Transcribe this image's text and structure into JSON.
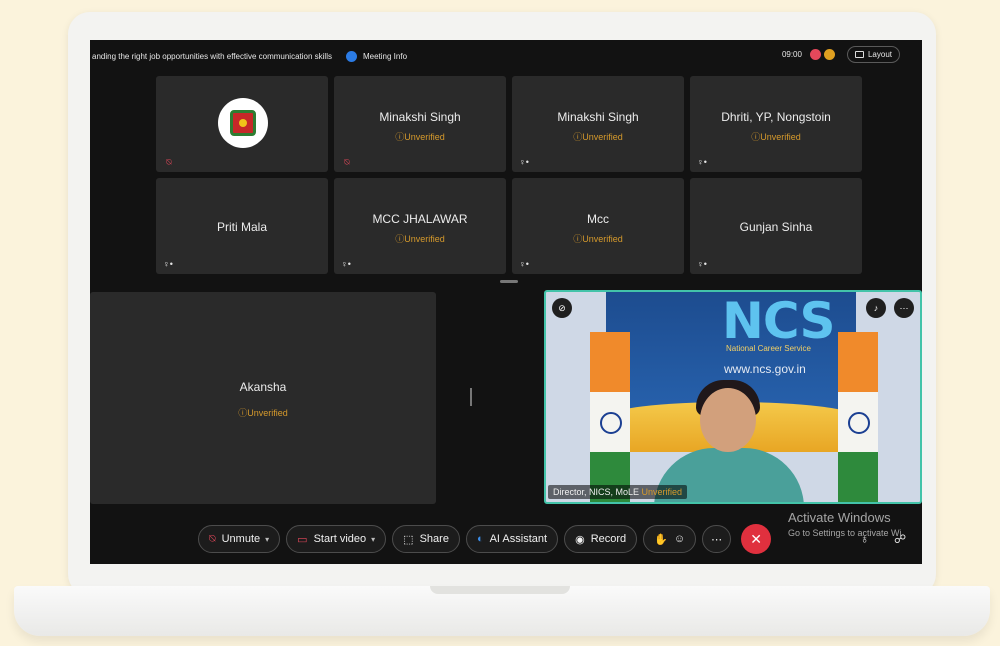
{
  "meeting": {
    "title": "anding the right job opportunities with effective communication skills",
    "info_label": "Meeting Info",
    "time": "09:00",
    "layout_label": "Layout"
  },
  "participants": [
    {
      "name": "",
      "status": "",
      "logo": true
    },
    {
      "name": "Minakshi Singh",
      "status": "ⓘUnverified"
    },
    {
      "name": "Minakshi Singh",
      "status": "ⓘUnverified"
    },
    {
      "name": "Dhriti, YP, Nongstoin",
      "status": "ⓘUnverified"
    },
    {
      "name": "Priti Mala",
      "status": ""
    },
    {
      "name": "MCC JHALAWAR",
      "status": "ⓘUnverified"
    },
    {
      "name": "Mcc",
      "status": "ⓘUnverified"
    },
    {
      "name": "Gunjan Sinha",
      "status": ""
    }
  ],
  "stage": {
    "name": "Akansha",
    "status": "ⓘUnverified"
  },
  "video": {
    "logo_text": "NCS",
    "logo_sub": "National Career Service",
    "url_text": "www.ncs.gov.in",
    "caption_name": "Director, NICS, MoLE",
    "caption_status": "Unverified"
  },
  "controls": {
    "unmute": "Unmute",
    "start_video": "Start video",
    "share": "Share",
    "ai_assistant": "AI Assistant",
    "record": "Record"
  },
  "watermark": {
    "line1": "Activate Windows",
    "line2": "Go to Settings to activate Wi"
  },
  "colors": {
    "accent": "#43c3a9",
    "unverified": "#d69a2c",
    "end_call": "#e0303e",
    "muted": "#e5485b"
  },
  "icons": [
    "info-icon",
    "layout-icon",
    "muted-mic-icon",
    "mic-icon",
    "video-icon",
    "share-icon",
    "ai-icon",
    "record-icon",
    "hand-icon",
    "reaction-icon",
    "more-icon",
    "close-icon",
    "people-icon",
    "chat-icon"
  ]
}
